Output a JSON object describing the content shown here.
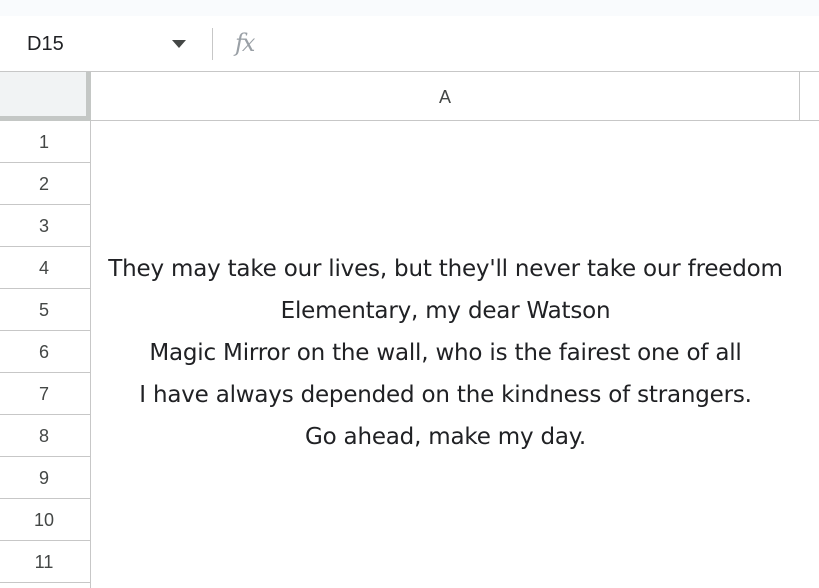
{
  "formula_bar": {
    "name_box": "D15",
    "fx_label": "fx"
  },
  "columns": [
    {
      "label": "A"
    }
  ],
  "rows": [
    {
      "num": "1",
      "a": ""
    },
    {
      "num": "2",
      "a": ""
    },
    {
      "num": "3",
      "a": ""
    },
    {
      "num": "4",
      "a": "They may take our lives, but they'll never take our freedom"
    },
    {
      "num": "5",
      "a": "Elementary, my dear Watson"
    },
    {
      "num": "6",
      "a": "Magic Mirror on the wall, who is the fairest one of all"
    },
    {
      "num": "7",
      "a": "I have always depended on the kindness of strangers."
    },
    {
      "num": "8",
      "a": "Go ahead, make my day."
    },
    {
      "num": "9",
      "a": ""
    },
    {
      "num": "10",
      "a": ""
    },
    {
      "num": "11",
      "a": ""
    }
  ]
}
